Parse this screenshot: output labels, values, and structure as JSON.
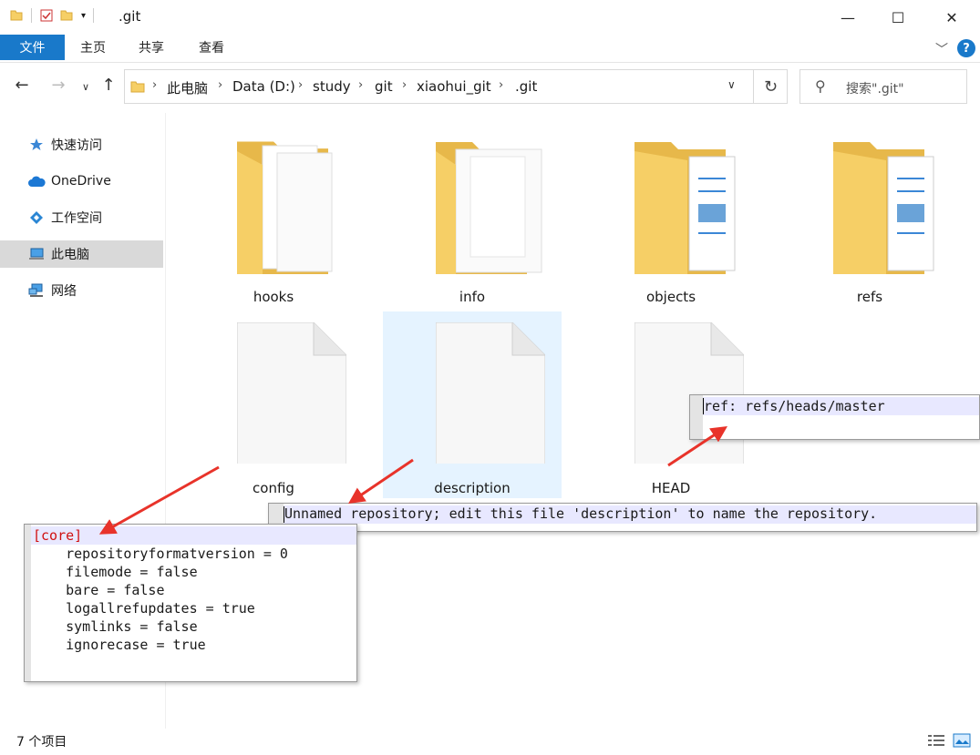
{
  "titlebar": {
    "title": ".git",
    "minimize": "—",
    "maximize": "☐",
    "close": "✕"
  },
  "ribbon": {
    "tabs": [
      "文件",
      "主页",
      "共享",
      "查看"
    ]
  },
  "address": {
    "crumbs": [
      "此电脑",
      "Data (D:)",
      "study",
      "git",
      "xiaohui_git",
      ".git"
    ],
    "search_placeholder": "搜索\".git\""
  },
  "sidebar": {
    "items": [
      "快速访问",
      "OneDrive",
      "工作空间",
      "此电脑",
      "网络"
    ],
    "selected": "此电脑"
  },
  "items": [
    {
      "label": "hooks",
      "type": "folder"
    },
    {
      "label": "info",
      "type": "folder"
    },
    {
      "label": "objects",
      "type": "folder"
    },
    {
      "label": "refs",
      "type": "folder"
    },
    {
      "label": "config",
      "type": "file"
    },
    {
      "label": "description",
      "type": "file"
    },
    {
      "label": "HEAD",
      "type": "file"
    }
  ],
  "selected_item": "description",
  "status": {
    "count": "7 个项目"
  },
  "overlays": {
    "head": {
      "lines": [
        "ref: refs/heads/master"
      ]
    },
    "description": {
      "lines": [
        "Unnamed repository; edit this file 'description' to name the repository."
      ]
    },
    "config": {
      "header": "[core]",
      "lines": [
        "    repositoryformatversion = 0",
        "    filemode = false",
        "    bare = false",
        "    logallrefupdates = true",
        "    symlinks = false",
        "    ignorecase = true"
      ]
    }
  },
  "colors": {
    "accent": "#1979ca",
    "annotation_arrow": "#e8332a",
    "selection": "#e5f3ff",
    "folder": "#f6cf66"
  }
}
